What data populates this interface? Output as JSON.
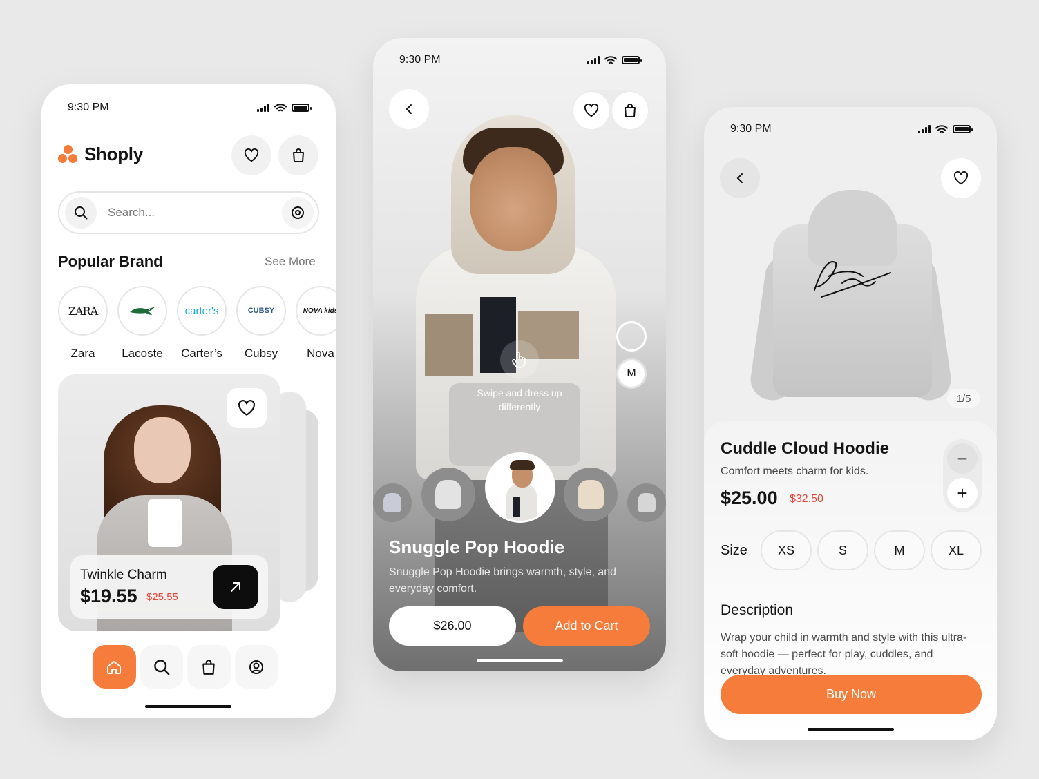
{
  "status": {
    "time": "9:30 PM"
  },
  "home": {
    "brand_name": "Shoply",
    "search_placeholder": "Search...",
    "popular_title": "Popular Brand",
    "see_more": "See More",
    "brands": [
      {
        "logo": "ZARA",
        "name": "Zara"
      },
      {
        "logo": "crocodile",
        "name": "Lacoste"
      },
      {
        "logo": "carter's",
        "name": "Carter’s"
      },
      {
        "logo": "CUBSY",
        "name": "Cubsy"
      },
      {
        "logo": "NOVA kids",
        "name": "Nova"
      }
    ],
    "product": {
      "name": "Twinkle Charm",
      "price": "$19.55",
      "old_price": "$25.55"
    },
    "nav": [
      "home-icon",
      "search-icon",
      "bag-icon",
      "profile-icon"
    ]
  },
  "tryon": {
    "size": "M",
    "hint": "Swipe and dress up differently",
    "title": "Snuggle Pop Hoodie",
    "description": "Snuggle Pop Hoodie brings warmth, style, and everyday comfort.",
    "price": "$26.00",
    "cta": "Add to Cart"
  },
  "detail": {
    "counter": "1/5",
    "title": "Cuddle Cloud Hoodie",
    "subtitle": "Comfort meets charm for kids.",
    "price": "$25.00",
    "old_price": "$32.50",
    "minus": "−",
    "plus": "+",
    "size_label": "Size",
    "sizes": [
      "XS",
      "S",
      "M",
      "XL"
    ],
    "description_title": "Description",
    "description": "Wrap your child in warmth and style with this ultra-soft hoodie — perfect for play, cuddles, and everyday adventures.",
    "cta": "Buy Now"
  },
  "colors": {
    "accent": "#f57c3a",
    "sale": "#e0463a",
    "dark": "#0d0d0d"
  }
}
